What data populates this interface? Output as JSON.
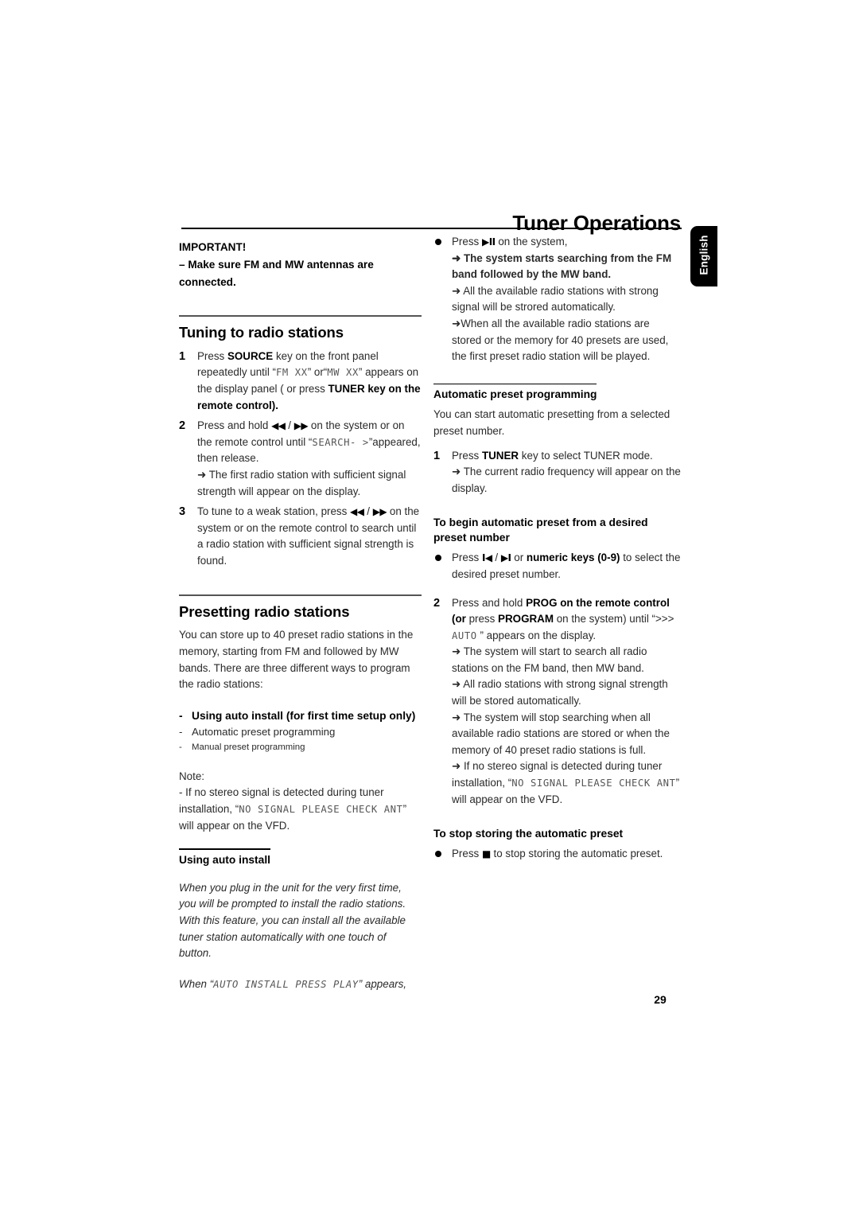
{
  "document": {
    "title": "Tuner Operations",
    "language_tab": "English",
    "page_number": "29"
  },
  "left_column": {
    "important": {
      "heading": "IMPORTANT!",
      "line": "–  Make sure FM and MW antennas are connected."
    },
    "tuning_section": {
      "heading": "Tuning to radio stations",
      "steps": [
        {
          "number": "1",
          "parts": [
            {
              "t": "Press ",
              "s": "normal"
            },
            {
              "t": "SOURCE",
              "s": "bold"
            },
            {
              "t": " key on the front panel repeatedly until “",
              "s": "normal"
            },
            {
              "t": "FM XX",
              "s": "lcd"
            },
            {
              "t": "” or“",
              "s": "normal"
            },
            {
              "t": "MW XX",
              "s": "lcd"
            },
            {
              "t": "” appears on the display panel ( or press ",
              "s": "normal"
            },
            {
              "t": "TUNER",
              "s": "bold"
            },
            {
              "t": " key on the remote control).",
              "s": "bold"
            }
          ]
        },
        {
          "number": "2",
          "parts": [
            {
              "t": "Press and hold ",
              "s": "normal"
            },
            {
              "t": "◀◀",
              "s": "glyph"
            },
            {
              "t": " / ",
              "s": "normal"
            },
            {
              "t": "▶▶",
              "s": "glyph"
            },
            {
              "t": " on the system or on the remote control until “",
              "s": "normal"
            },
            {
              "t": "SEARCH- >",
              "s": "lcd"
            },
            {
              "t": "”appeared, then release.",
              "s": "normal"
            }
          ],
          "result": "➜ The first radio station with sufficient signal strength will appear on the display."
        },
        {
          "number": "3",
          "parts": [
            {
              "t": "To tune to a weak station, press ",
              "s": "normal"
            },
            {
              "t": "◀◀",
              "s": "glyph"
            },
            {
              "t": " / ",
              "s": "normal"
            },
            {
              "t": "▶▶",
              "s": "glyph"
            },
            {
              "t": " on the system or on the remote control to search until a radio station with sufficient signal strength is found.",
              "s": "normal"
            }
          ]
        }
      ]
    },
    "presetting_section": {
      "heading": "Presetting radio stations",
      "intro": "You can store up to 40  preset radio stations in the memory, starting from FM and followed by MW bands. There are three different ways to program the radio stations:",
      "methods": [
        "Using auto install (for first time setup only)",
        "Automatic preset programming",
        "Manual preset programming"
      ],
      "note_label": "Note:",
      "note": {
        "before": "-  If  no stereo signal is detected during tuner installation, “",
        "lcd": "NO SIGNAL PLEASE CHECK ANT",
        "after": "” will appear on the VFD."
      }
    },
    "auto_install": {
      "heading": "Using auto install",
      "body": "When you plug in the unit  for the very  first time, you will be prompted to install  the radio stations. With this feature, you can install all the available tuner station  automatically with one touch of button.",
      "prompt_before": "When “",
      "prompt_lcd": "AUTO INSTALL PRESS PLAY",
      "prompt_after": "” appears,"
    }
  },
  "right_column": {
    "auto_install_continued": {
      "press_label": "Press",
      "press_glyph": "▶II",
      "press_tail": " on the system,",
      "results": [
        {
          "text": "➜ The system starts searching from the FM band followed by the MW band.",
          "bold": true
        },
        {
          "text": "➜ All the available radio stations with strong signal will be strored automatically.",
          "bold": false
        },
        {
          "text": "➜When all the available radio stations are stored or the memory for 40 presets are used, the first preset radio station will be played.",
          "bold": false
        }
      ]
    },
    "automatic_preset": {
      "heading": "Automatic preset programming",
      "intro": "You can start automatic presetting from a selected preset number.",
      "step1": {
        "number": "1",
        "parts": [
          {
            "t": "Press ",
            "s": "normal"
          },
          {
            "t": "TUNER",
            "s": "bold"
          },
          {
            "t": " key to select TUNER mode.",
            "s": "normal"
          }
        ],
        "result": "➜ The current radio frequency will appear on the display."
      },
      "begin_heading": "To begin automatic preset from a desired preset number",
      "begin_bullet": [
        {
          "t": "Press ",
          "s": "normal"
        },
        {
          "t": "I◀",
          "s": "glyph"
        },
        {
          "t": " / ",
          "s": "normal"
        },
        {
          "t": "▶I",
          "s": "glyph"
        },
        {
          "t": " or ",
          "s": "normal"
        },
        {
          "t": "numeric keys (0-9)",
          "s": "bold"
        },
        {
          "t": " to select the desired preset number.",
          "s": "normal"
        }
      ],
      "step2": {
        "number": "2",
        "parts": [
          {
            "t": "Press and hold ",
            "s": "normal"
          },
          {
            "t": "PROG",
            "s": "bold"
          },
          {
            "t": " on the remote control (or",
            "s": "bold"
          },
          {
            "t": " press ",
            "s": "normal"
          },
          {
            "t": "PROGRAM",
            "s": "bold"
          },
          {
            "t": " on the system) until “>>> ",
            "s": "normal"
          },
          {
            "t": "AUTO",
            "s": "lcd"
          },
          {
            "t": " ” appears on the display.",
            "s": "normal"
          }
        ],
        "results": [
          "➜ The system will start to search all radio stations on the FM band, then MW band.",
          "➜ All radio stations with strong signal strength will be stored automatically.",
          "➜ The system will stop searching when all available radio stations are stored or when the memory of 40 preset radio stations is full."
        ],
        "note_before": "➜ If no stereo signal is detected during tuner installation, “",
        "note_lcd": "NO SIGNAL PLEASE CHECK ANT",
        "note_after": "” will appear on the VFD."
      },
      "stop_heading": "To stop storing the automatic preset",
      "stop_bullet": [
        {
          "t": "Press ",
          "s": "normal"
        },
        {
          "t": "■",
          "s": "glyph"
        },
        {
          "t": " to stop storing the automatic preset.",
          "s": "normal"
        }
      ]
    }
  }
}
